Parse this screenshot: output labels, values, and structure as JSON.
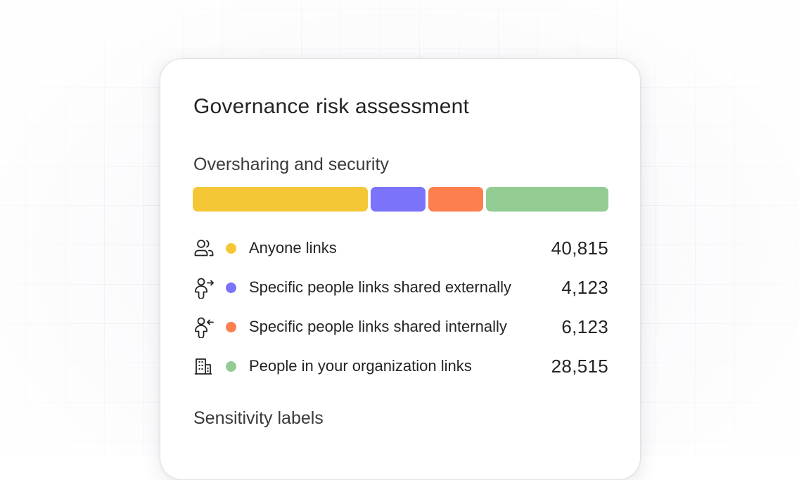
{
  "card": {
    "title": "Governance risk assessment"
  },
  "oversharing": {
    "title": "Oversharing and security",
    "segments": [
      {
        "label": "Anyone links",
        "color": "#f5c635",
        "value": 40815
      },
      {
        "label": "Specific people links shared externally",
        "color": "#7b74fb",
        "value": 4123
      },
      {
        "label": "Specific people links shared internally",
        "color": "#fd7f50",
        "value": 6123
      },
      {
        "label": "People in your organization links",
        "color": "#92cc93",
        "value": 28515
      }
    ],
    "rows": [
      {
        "icon": "people-icon",
        "label": "Anyone links",
        "value": "40,815",
        "color": "#f5c635"
      },
      {
        "icon": "person-arrow-right-icon",
        "label": "Specific people links shared externally",
        "value": "4,123",
        "color": "#7b74fb"
      },
      {
        "icon": "person-arrow-left-icon",
        "label": "Specific people links shared internally",
        "value": "6,123",
        "color": "#fd7f50"
      },
      {
        "icon": "building-icon",
        "label": "People in your organization links",
        "value": "28,515",
        "color": "#92cc93"
      }
    ]
  },
  "sensitivity": {
    "title": "Sensitivity labels"
  }
}
